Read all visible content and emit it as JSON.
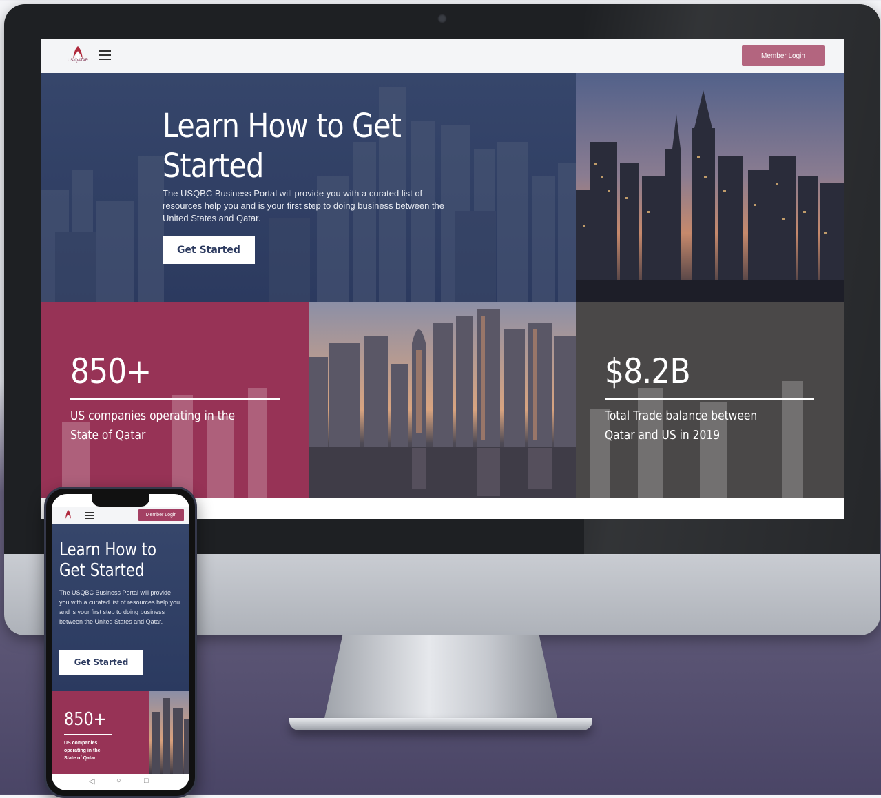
{
  "desktop": {
    "nav": {
      "logo_text": "US-QATAR",
      "member_login": "Member Login"
    },
    "hero": {
      "title": "Learn How to Get Started",
      "description": "The USQBC Business Portal will provide you with a curated list of resources help you and is your first step to doing business between the United States and Qatar.",
      "button": "Get Started"
    },
    "stats": [
      {
        "value": "850+",
        "label": "US companies operating in the State of Qatar"
      },
      {
        "value": "$8.2B",
        "label": "Total Trade balance between Qatar and US in 2019"
      }
    ]
  },
  "mobile": {
    "nav": {
      "member_login": "Member Login"
    },
    "hero": {
      "title": "Learn How to Get Started",
      "description": "The USQBC Business Portal will provide you with a curated list of resources help you and is your first step to doing business between the United States and Qatar.",
      "button": "Get Started"
    },
    "stat": {
      "value": "850+",
      "label": "US companies operating in the State of Qatar"
    },
    "nav_icons": [
      "back-icon",
      "home-icon",
      "recents-icon"
    ]
  },
  "colors": {
    "brand_maroon": "#973356",
    "login_button": "#b3657f",
    "hero_navy": "#2c3a5f",
    "stat_gray": "#4a4848"
  }
}
